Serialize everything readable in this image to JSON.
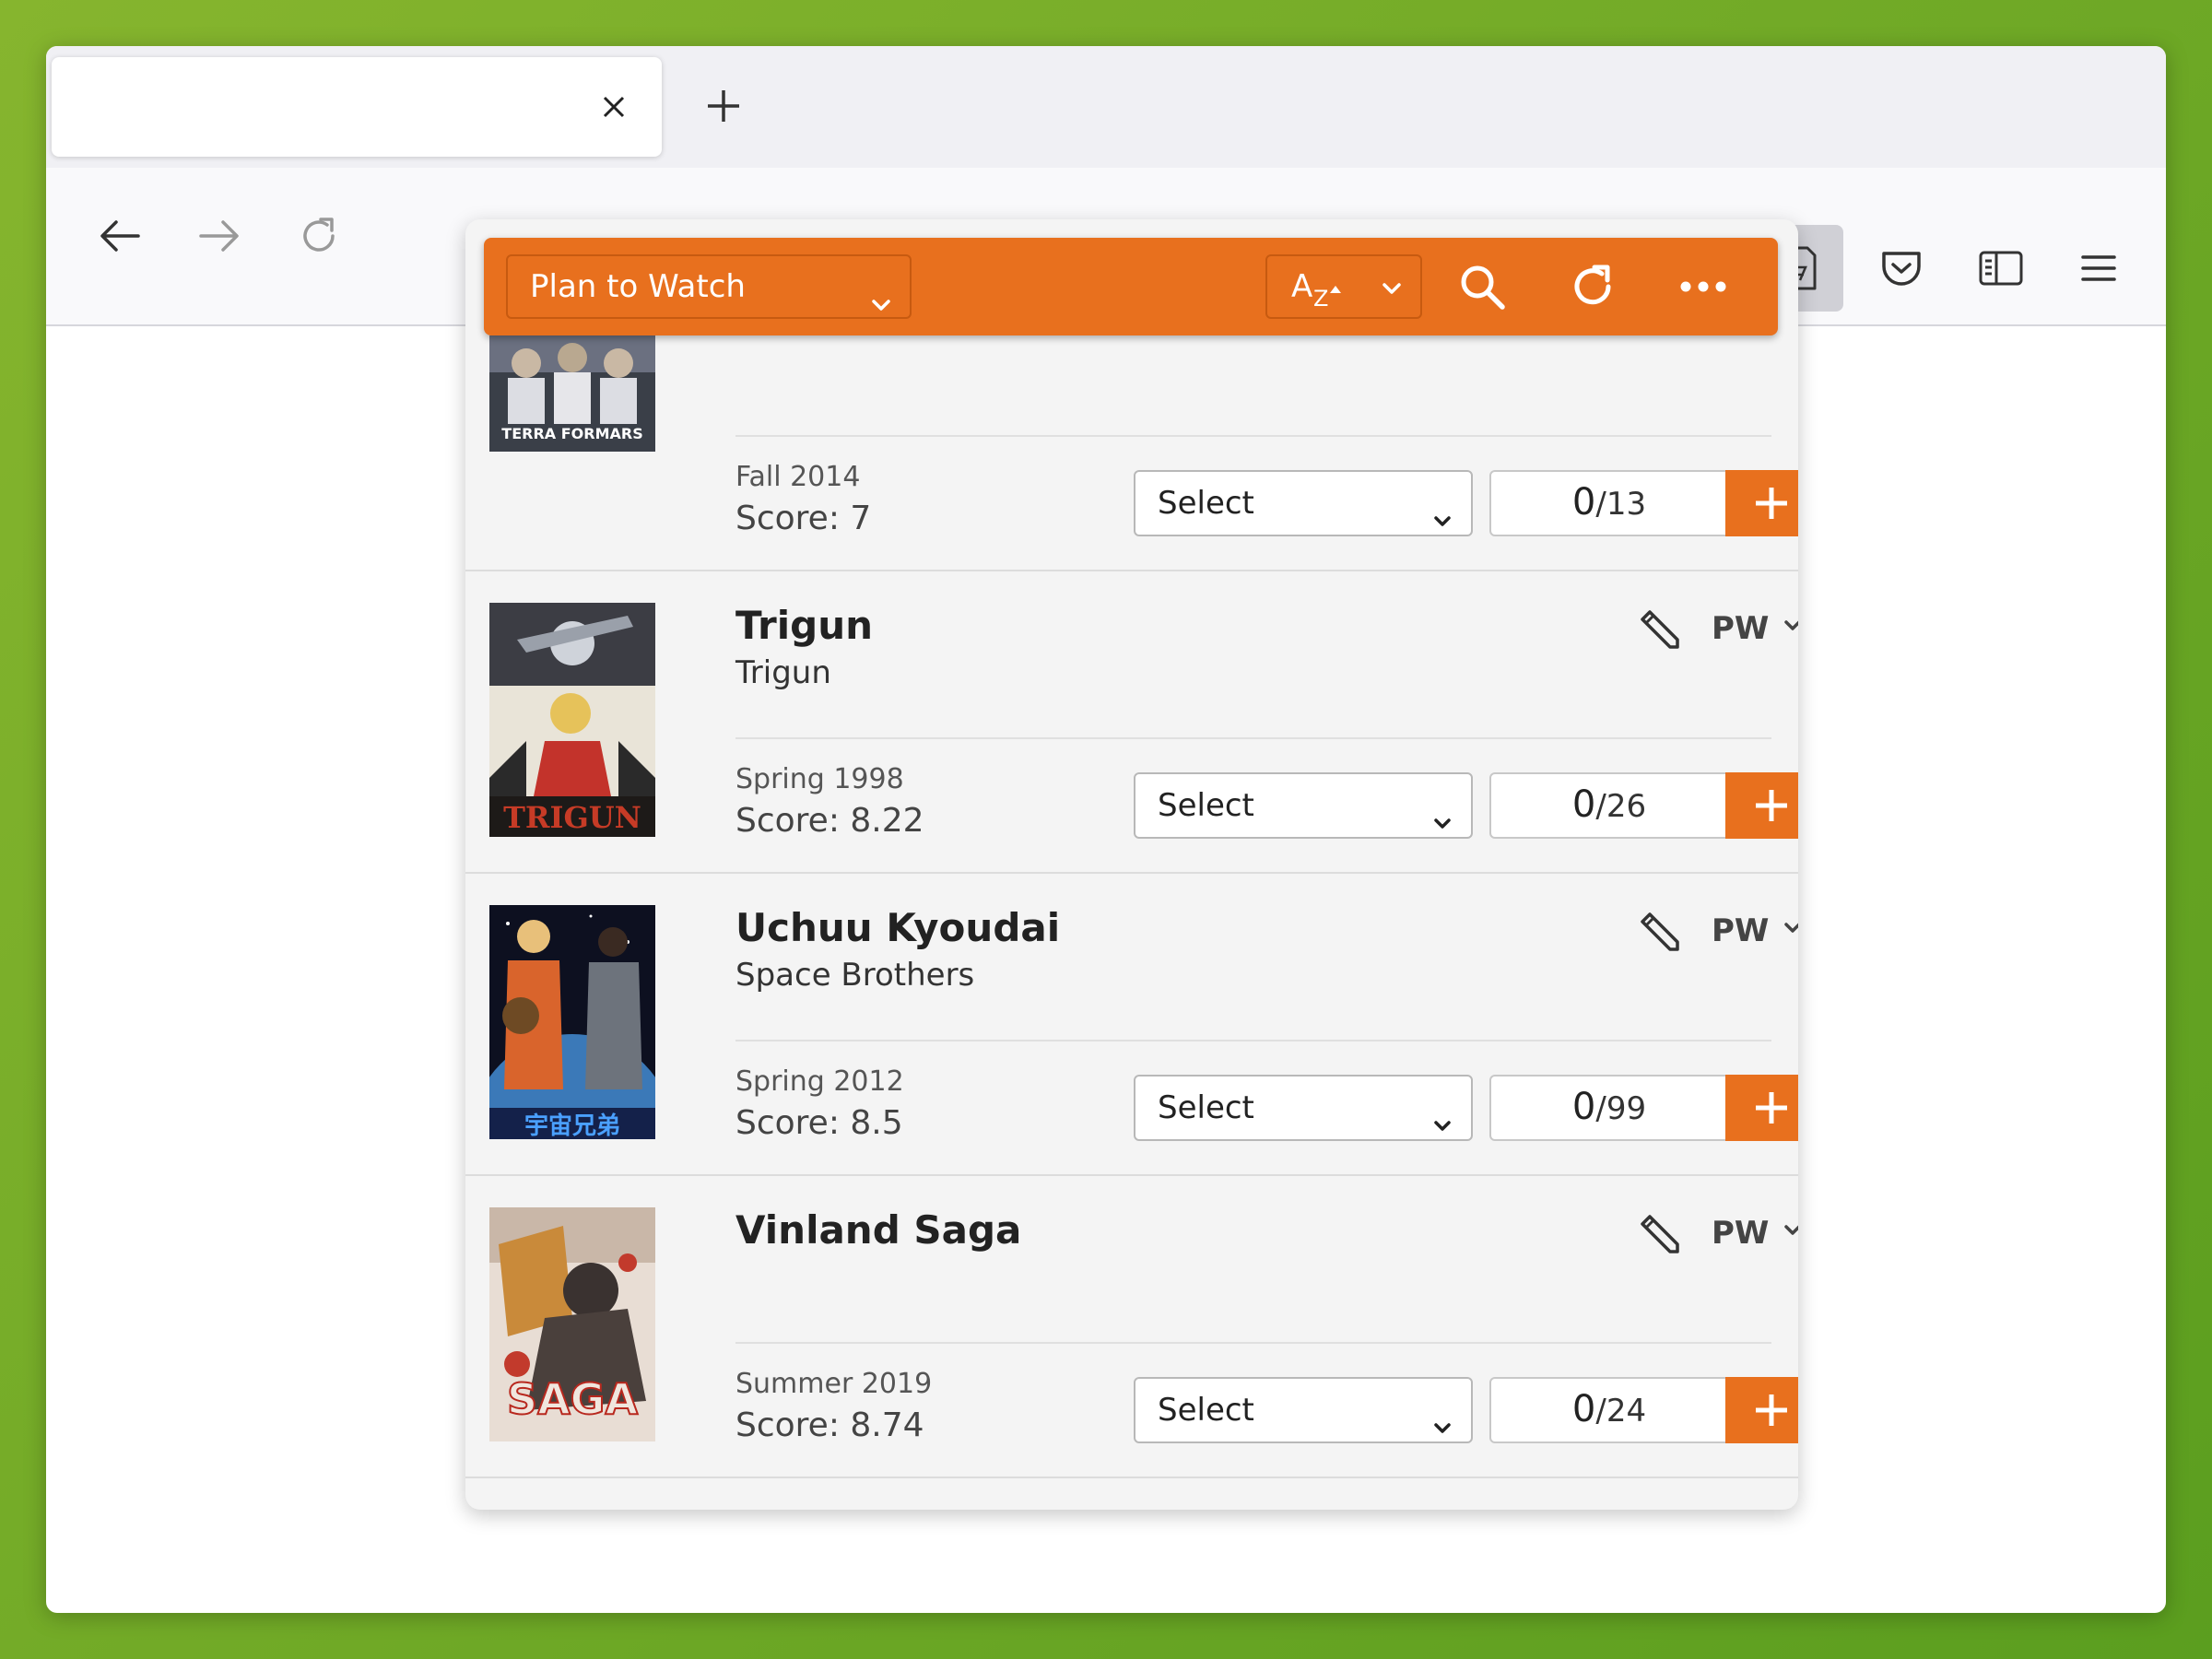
{
  "browser": {
    "tab_title": "",
    "url": "",
    "new_tab_icon": "plus-icon"
  },
  "toolbar": {
    "icons": [
      "back-icon",
      "forward-icon",
      "reload-icon",
      "search-icon",
      "extension-icon",
      "pocket-icon",
      "sidebar-icon",
      "menu-icon"
    ]
  },
  "popup": {
    "accent_color": "#e8701e",
    "list_filter": "Plan to Watch",
    "sort_label": "AZ",
    "entries": [
      {
        "title": "",
        "subtitle": "",
        "season": "Fall 2014",
        "score": "Score: 7",
        "status": "Select",
        "progress": "0",
        "total": "/13",
        "poster_text": "TERRA FORMARS",
        "status_code": ""
      },
      {
        "title": "Trigun",
        "subtitle": "Trigun",
        "season": "Spring 1998",
        "score": "Score: 8.22",
        "status": "Select",
        "progress": "0",
        "total": "/26",
        "poster_text": "TRIGUN",
        "status_code": "PW"
      },
      {
        "title": "Uchuu Kyoudai",
        "subtitle": "Space Brothers",
        "season": "Spring 2012",
        "score": "Score: 8.5",
        "status": "Select",
        "progress": "0",
        "total": "/99",
        "poster_text": "宇宙兄弟",
        "status_code": "PW"
      },
      {
        "title": "Vinland Saga",
        "subtitle": "",
        "season": "Summer 2019",
        "score": "Score: 8.74",
        "status": "Select",
        "progress": "0",
        "total": "/24",
        "poster_text": "SAGA",
        "status_code": "PW"
      }
    ]
  }
}
